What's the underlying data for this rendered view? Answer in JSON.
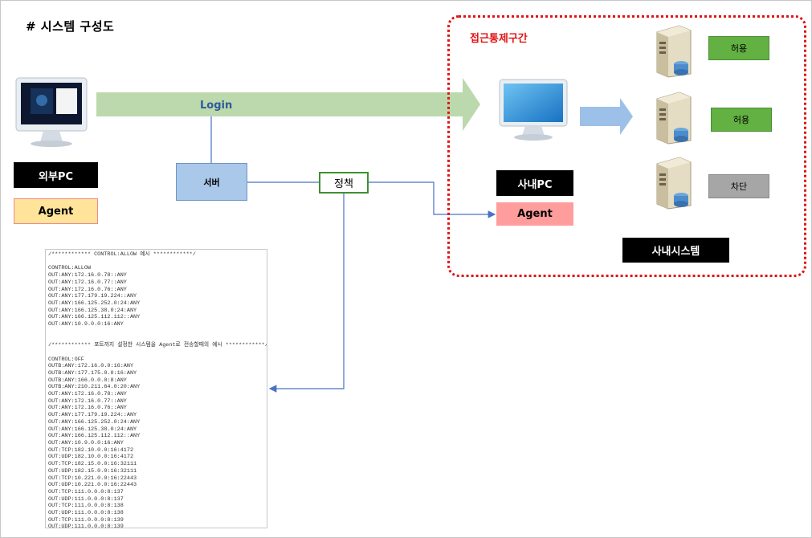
{
  "title": "# 시스템 구성도",
  "zone_label": "접근통제구간",
  "external": {
    "pc_label": "외부PC",
    "agent_label": "Agent"
  },
  "internal": {
    "pc_label": "사내PC",
    "agent_label": "Agent"
  },
  "server_label": "서버",
  "policy_label": "정책",
  "login_label": "Login",
  "systems": {
    "label": "사내시스템",
    "statuses": [
      "허용",
      "허용",
      "차단"
    ]
  },
  "policy_sample": {
    "lines": [
      "/************ CONTROL:ALLOW 예시 ************/",
      "",
      "CONTROL:ALLOW",
      "OUT:ANY:172.16.0.78::ANY",
      "OUT:ANY:172.16.0.77::ANY",
      "OUT:ANY:172.16.0.76::ANY",
      "OUT:ANY:177.179.19.224::ANY",
      "OUT:ANY:166.125.252.0:24:ANY",
      "OUT:ANY:166.125.38.0:24:ANY",
      "OUT:ANY:166.125.112.112::ANY",
      "OUT:ANY:10.9.0.0:16:ANY",
      "",
      "",
      "/************ 포트까지 설정한 시스템을 Agent로 전송할때의 예시 ************/",
      "",
      "CONTROL:OFF",
      "OUTB:ANY:172.16.0.0:16:ANY",
      "OUTB:ANY:177.175.0.0:16:ANY",
      "OUTB:ANY:166.0.0.0:8:ANY",
      "OUTB:ANY:210.211.64.0:20:ANY",
      "OUT:ANY:172.16.0.78::ANY",
      "OUT:ANY:172.16.0.77::ANY",
      "OUT:ANY:172.16.0.76::ANY",
      "OUT:ANY:177.179.19.224::ANY",
      "OUT:ANY:166.125.252.0:24:ANY",
      "OUT:ANY:166.125.38.0:24:ANY",
      "OUT:ANY:166.125.112.112::ANY",
      "OUT:ANY:10.9.0.0:16:ANY",
      "OUT:TCP:182.10.0.0:16:4172",
      "OUT:UDP:182.10.0.0:16:4172",
      "OUT:TCP:182.15.0.0:16:32111",
      "OUT:UDP:182.15.0.0:16:32111",
      "OUT:TCP:10.221.0.0:16:22443",
      "OUT:UDP:10.221.0.0:16:22443",
      "OUT:TCP:111.0.0.0:8:137",
      "OUT:UDP:111.0.0.0:8:137",
      "OUT:TCP:111.0.0.0:8:138",
      "OUT:UDP:111.0.0.0:8:138",
      "OUT:TCP:111.0.0.0:8:139",
      "OUT:UDP:111.0.0.0:8:139"
    ]
  }
}
